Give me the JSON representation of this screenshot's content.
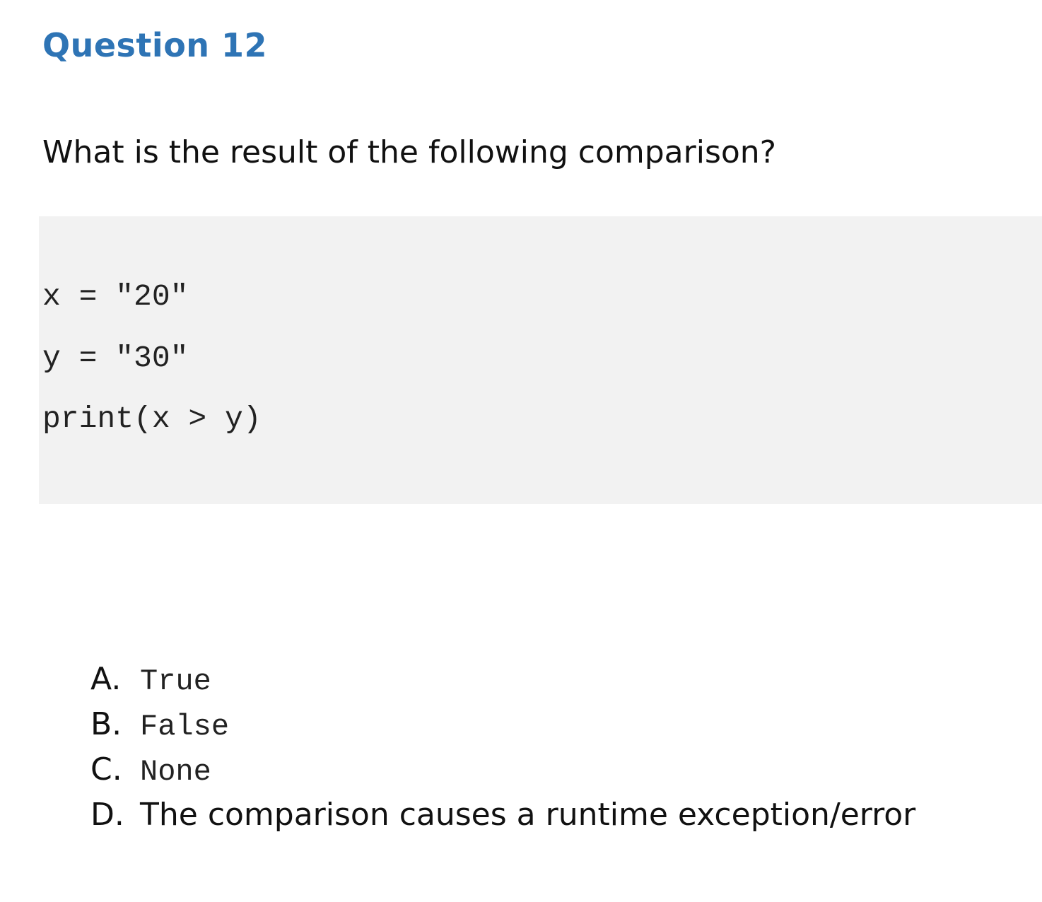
{
  "question": {
    "heading": "Question 12",
    "prompt": "What is the result of the following comparison?"
  },
  "code": {
    "lines": [
      "x = \"20\"",
      "y = \"30\"",
      "print(x > y)"
    ]
  },
  "options": [
    {
      "letter": "A.",
      "text": "True",
      "style": "mono"
    },
    {
      "letter": "B.",
      "text": "False",
      "style": "mono"
    },
    {
      "letter": "C.",
      "text": "None",
      "style": "mono"
    },
    {
      "letter": "D.",
      "text": "The comparison causes a runtime exception/error",
      "style": "sans"
    }
  ],
  "colors": {
    "heading": "#2e74b5",
    "code_background": "#f2f2f2",
    "text": "#111111"
  }
}
